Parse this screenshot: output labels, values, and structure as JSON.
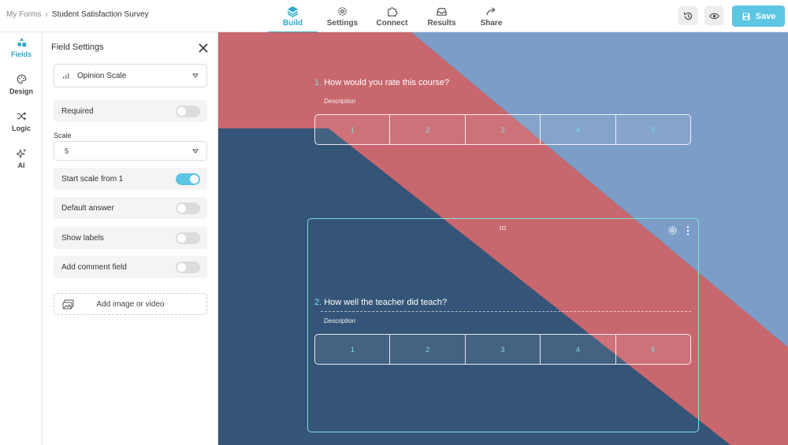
{
  "breadcrumb": {
    "root": "My Forms",
    "separator": "›",
    "current": "Student Satisfaction Survey"
  },
  "nav": {
    "tabs": [
      {
        "label": "Build",
        "icon": "layers-icon",
        "active": true
      },
      {
        "label": "Settings",
        "icon": "gear-icon"
      },
      {
        "label": "Connect",
        "icon": "puzzle-icon"
      },
      {
        "label": "Results",
        "icon": "inbox-icon"
      },
      {
        "label": "Share",
        "icon": "share-arrow-icon"
      }
    ]
  },
  "actions": {
    "history_icon": "history-icon",
    "preview_icon": "eye-icon",
    "save_label": "Save"
  },
  "rail": {
    "items": [
      {
        "label": "Fields",
        "icon": "shapes-icon",
        "active": true
      },
      {
        "label": "Design",
        "icon": "palette-icon"
      },
      {
        "label": "Logic",
        "icon": "shuffle-icon"
      },
      {
        "label": "AI",
        "icon": "sparkle-icon"
      }
    ]
  },
  "panel": {
    "title": "Field Settings",
    "field_type": "Opinion Scale",
    "required_label": "Required",
    "required_on": false,
    "scale_label": "Scale",
    "scale_value": "5",
    "start_from_one_label": "Start scale from 1",
    "start_from_one_on": true,
    "default_answer_label": "Default answer",
    "default_answer_on": false,
    "show_labels_label": "Show labels",
    "show_labels_on": false,
    "comment_field_label": "Add comment field",
    "comment_field_on": false,
    "media_label": "Add image or video"
  },
  "form": {
    "questions": [
      {
        "number": "1.",
        "title": "How would you rate this course?",
        "description": "Description",
        "options": [
          "1",
          "2",
          "3",
          "4",
          "5"
        ]
      },
      {
        "number": "2.",
        "title": "How well the teacher did teach?",
        "description": "Description",
        "options": [
          "1",
          "2",
          "3",
          "4",
          "5"
        ]
      }
    ]
  },
  "colors": {
    "accent": "#2fa8c7",
    "save": "#5cc6e3",
    "red_band": "#c9676e",
    "blue_dark": "#355578",
    "blue_light": "#7b9dc7"
  }
}
